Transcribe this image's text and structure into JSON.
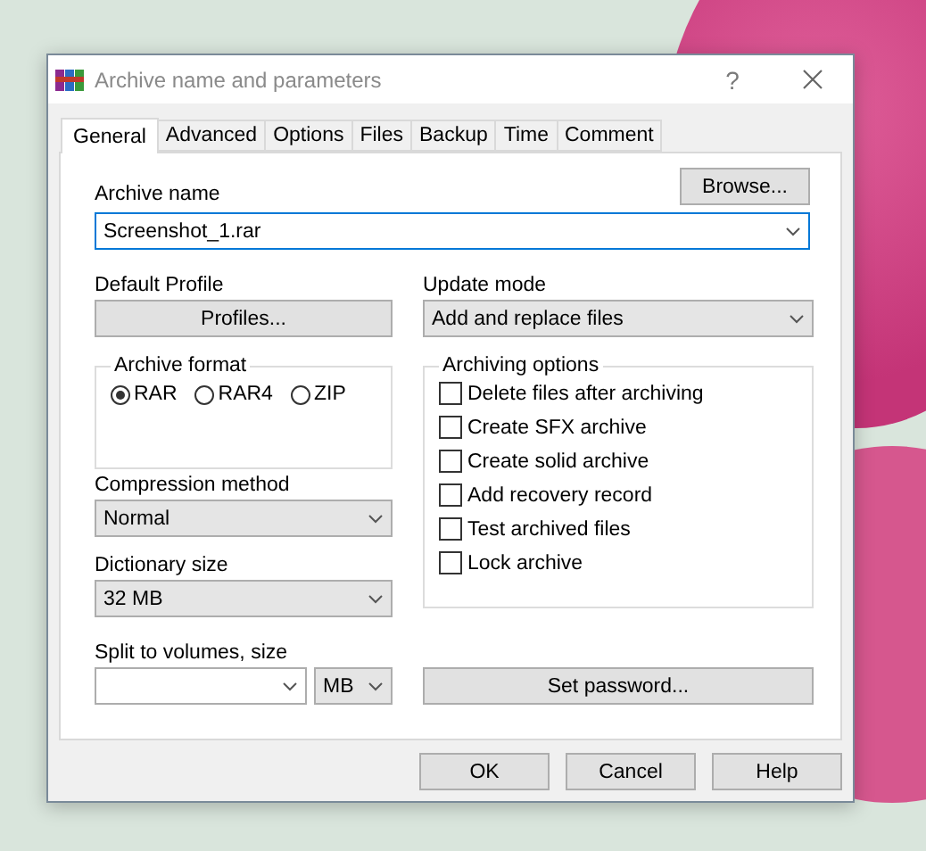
{
  "window": {
    "title": "Archive name and parameters",
    "help_button": "?"
  },
  "tabs": [
    {
      "label": "General",
      "selected": true
    },
    {
      "label": "Advanced",
      "selected": false
    },
    {
      "label": "Options",
      "selected": false
    },
    {
      "label": "Files",
      "selected": false
    },
    {
      "label": "Backup",
      "selected": false
    },
    {
      "label": "Time",
      "selected": false
    },
    {
      "label": "Comment",
      "selected": false
    }
  ],
  "archive_name": {
    "label": "Archive name",
    "value": "Screenshot_1.rar",
    "browse_button": "Browse..."
  },
  "default_profile": {
    "label": "Default Profile",
    "button": "Profiles..."
  },
  "update_mode": {
    "label": "Update mode",
    "value": "Add and replace files"
  },
  "archive_format": {
    "label": "Archive format",
    "options": [
      {
        "label": "RAR",
        "selected": true
      },
      {
        "label": "RAR4",
        "selected": false
      },
      {
        "label": "ZIP",
        "selected": false
      }
    ]
  },
  "compression_method": {
    "label": "Compression method",
    "value": "Normal"
  },
  "dictionary_size": {
    "label": "Dictionary size",
    "value": "32 MB"
  },
  "split_volumes": {
    "label": "Split to volumes, size",
    "unit": "MB"
  },
  "archiving_options": {
    "label": "Archiving options",
    "items": [
      {
        "label": "Delete files after archiving",
        "checked": false
      },
      {
        "label": "Create SFX archive",
        "checked": false
      },
      {
        "label": "Create solid archive",
        "checked": false
      },
      {
        "label": "Add recovery record",
        "checked": false
      },
      {
        "label": "Test archived files",
        "checked": false
      },
      {
        "label": "Lock archive",
        "checked": false
      }
    ]
  },
  "password_button": "Set password...",
  "buttons": [
    "OK",
    "Cancel",
    "Help"
  ]
}
